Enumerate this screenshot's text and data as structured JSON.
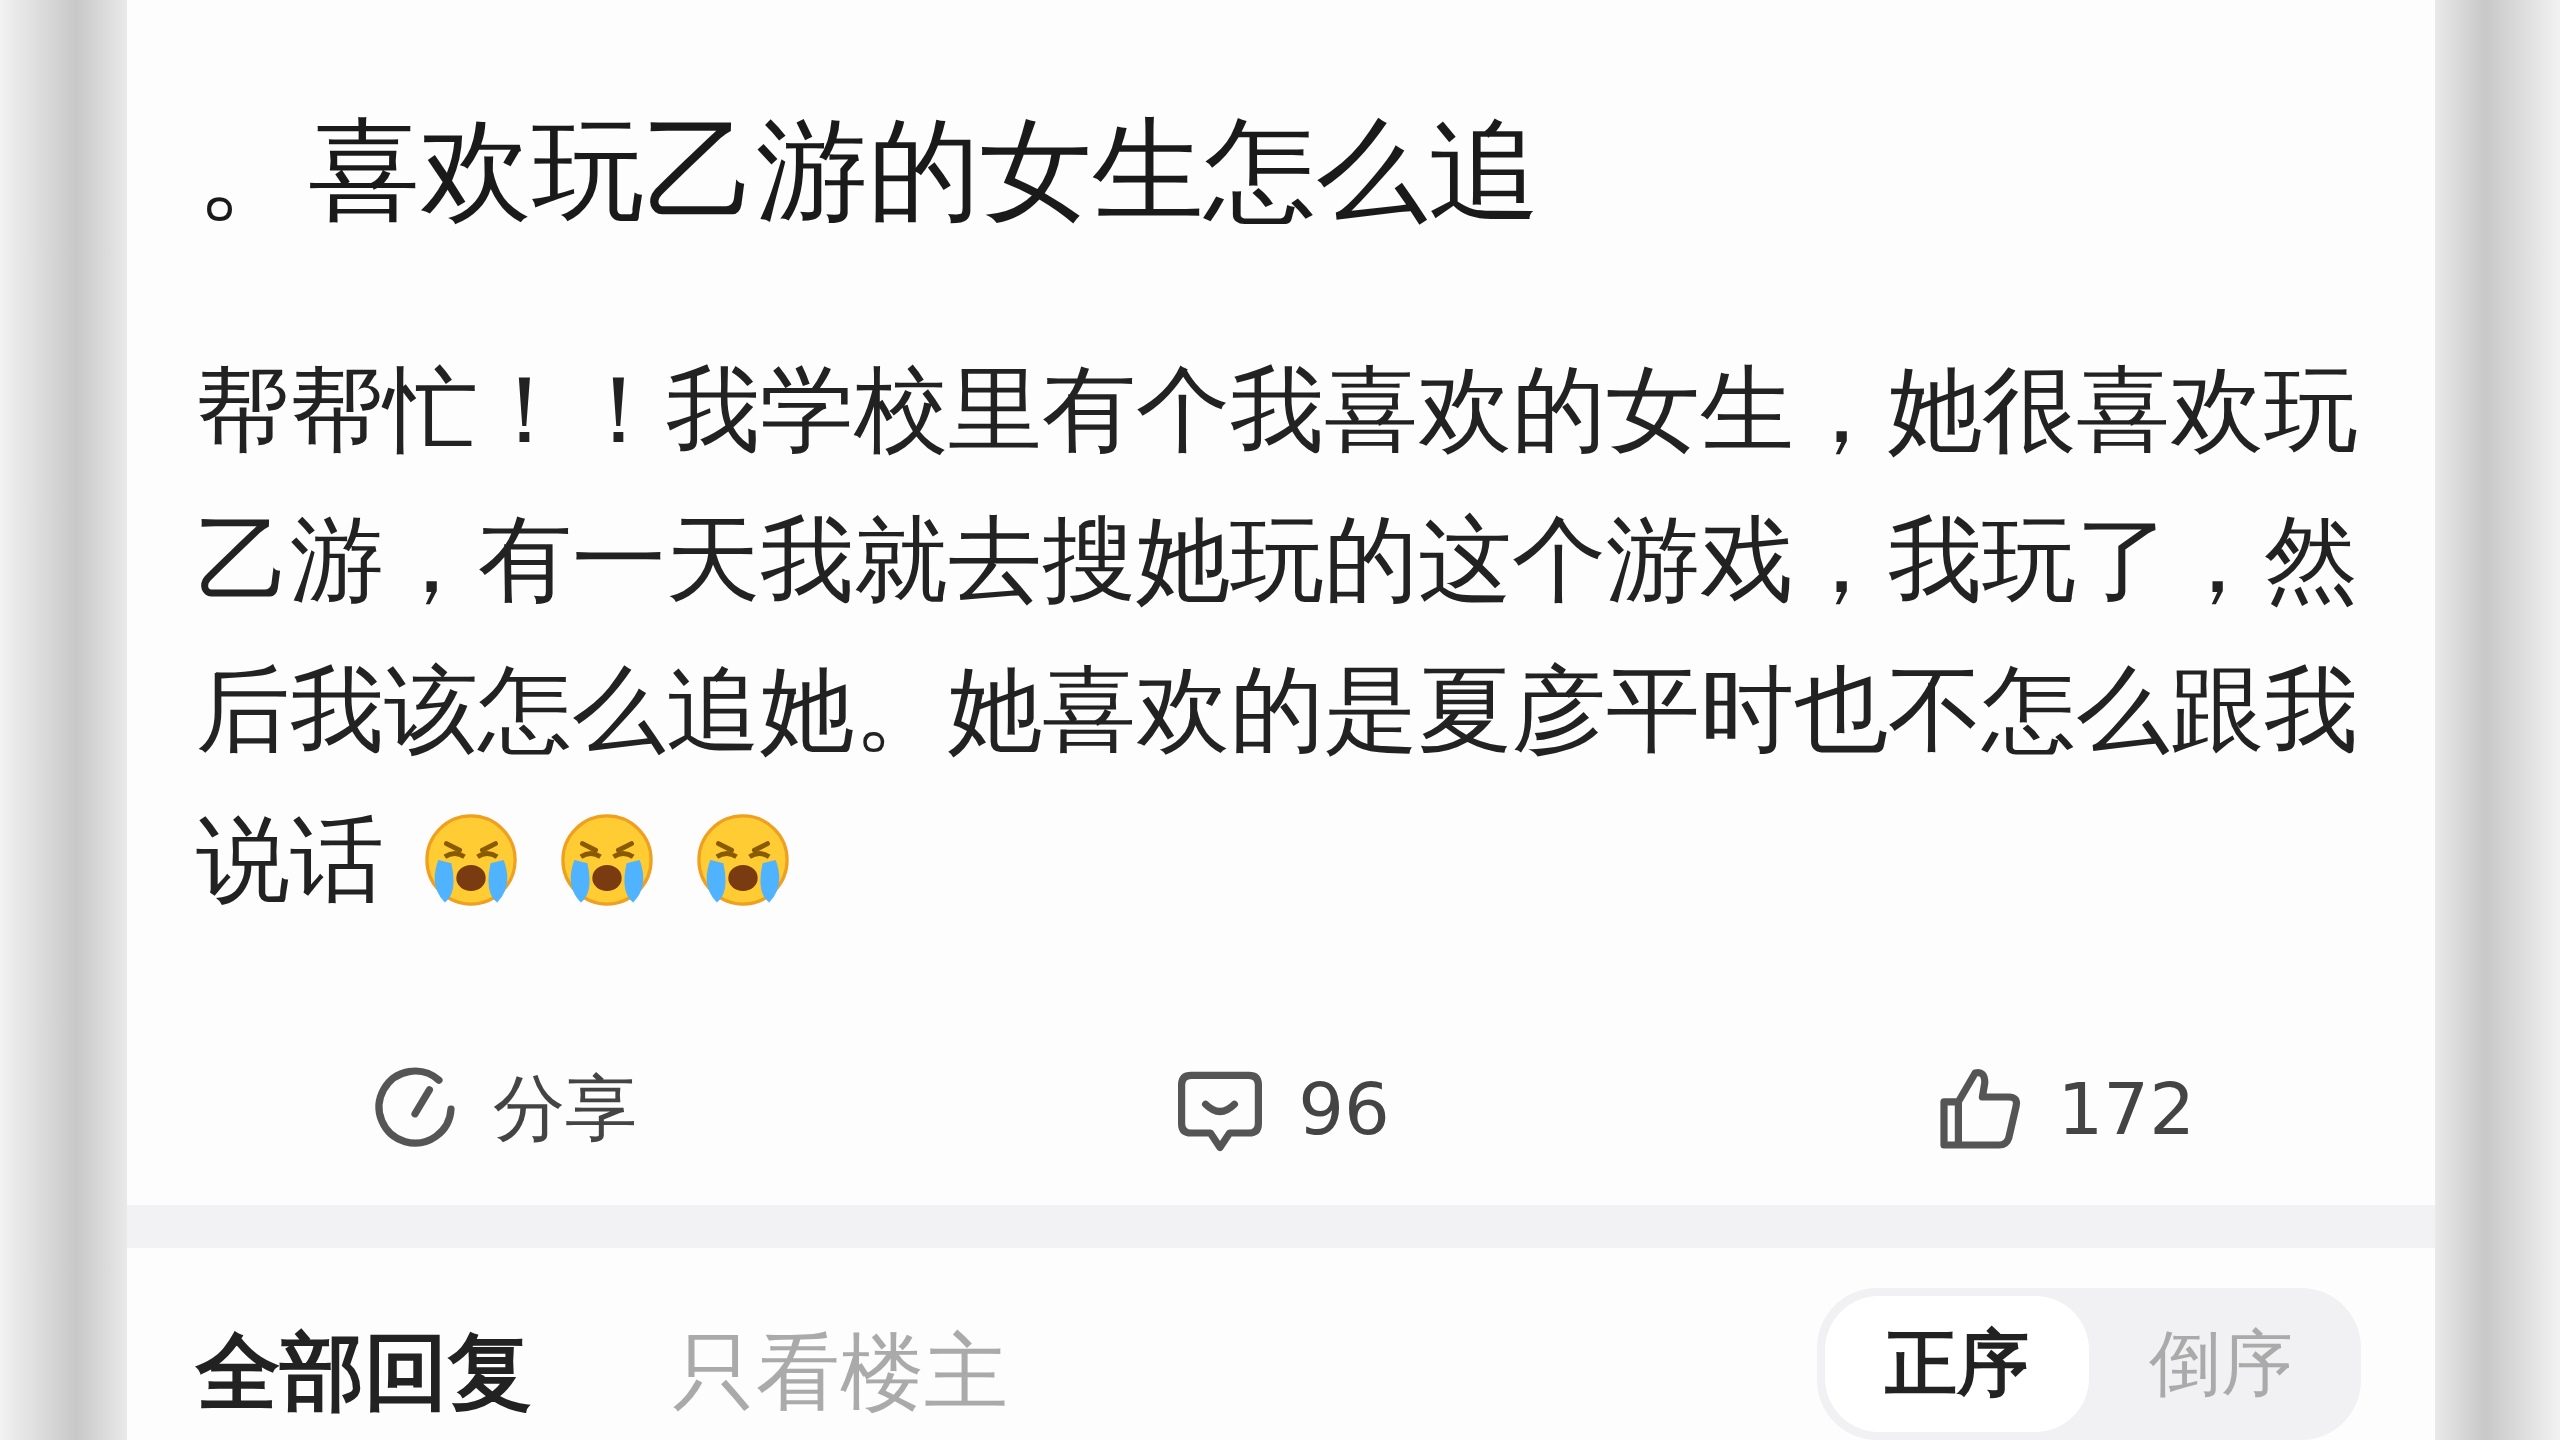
{
  "post": {
    "title": "。喜欢玩乙游的女生怎么追",
    "body_lines": [
      "帮帮忙！！我学校里有个我喜欢的女生，她很喜欢玩",
      "乙游，有一天我就去搜她玩的这个游戏，我玩了，然",
      "后我该怎么追她。她喜欢的是夏彦平时也不怎么跟我",
      "说话"
    ],
    "emojis": [
      {
        "kind": "crying"
      },
      {
        "kind": "crying"
      },
      {
        "kind": "crying"
      }
    ]
  },
  "actions": [
    {
      "kind": "share",
      "label": "分享"
    },
    {
      "kind": "comment",
      "label": "96"
    },
    {
      "kind": "like",
      "label": "172"
    }
  ],
  "reply_filters": [
    {
      "label": "全部回复",
      "selected": true
    },
    {
      "label": "只看楼主",
      "selected": false
    }
  ],
  "sort_order": [
    {
      "label": "正序",
      "selected": true
    },
    {
      "label": "倒序",
      "selected": false
    }
  ]
}
